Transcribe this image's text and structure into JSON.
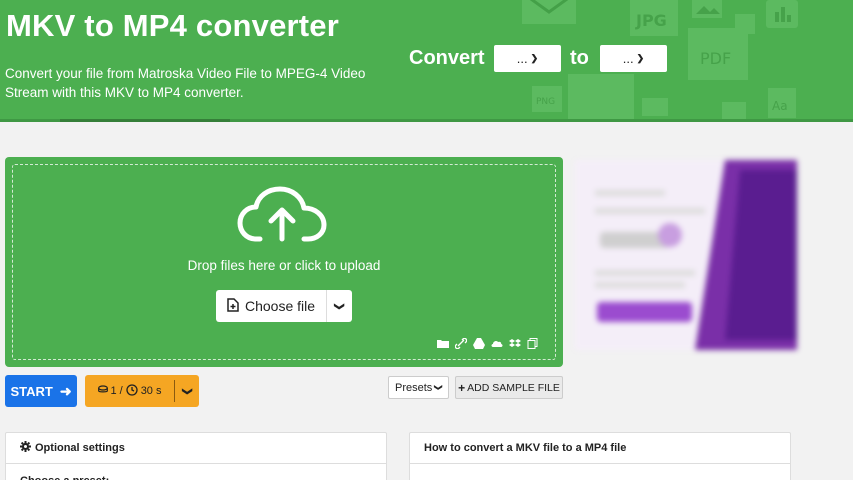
{
  "header": {
    "title": "MKV to MP4 converter",
    "description": "Convert your file from Matroska Video File to MPEG-4 Video Stream with this MKV to MP4 converter.",
    "convert_label": "Convert",
    "to_label": "to",
    "from_select": "...",
    "to_select": "...",
    "bg_color": "#4caf50"
  },
  "uploader": {
    "drop_text": "Drop files here or click to upload",
    "choose_label": "Choose file",
    "source_icons": [
      "folder-icon",
      "link-icon",
      "google-drive-icon",
      "onedrive-icon",
      "dropbox-icon",
      "clipboard-icon"
    ]
  },
  "actions": {
    "start_label": "START",
    "limit_files": "1",
    "limit_sep": "/",
    "limit_time": "30 s",
    "presets_label": "Presets",
    "sample_label": "ADD SAMPLE FILE",
    "start_color": "#1a73e8",
    "limit_color": "#f5a623"
  },
  "panels": {
    "optional_title": "Optional settings",
    "optional_sub": "Choose a preset:",
    "howto_title": "How to convert a MKV file to a MP4 file"
  }
}
